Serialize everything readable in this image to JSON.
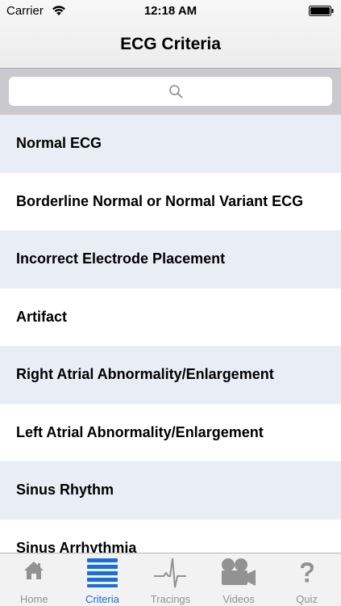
{
  "status_bar": {
    "carrier": "Carrier",
    "time": "12:18 AM"
  },
  "nav": {
    "title": "ECG Criteria"
  },
  "search": {
    "placeholder": ""
  },
  "list": {
    "items": [
      {
        "label": "Normal ECG"
      },
      {
        "label": "Borderline Normal or Normal Variant ECG"
      },
      {
        "label": "Incorrect Electrode Placement"
      },
      {
        "label": "Artifact"
      },
      {
        "label": "Right Atrial Abnormality/Enlargement"
      },
      {
        "label": "Left Atrial Abnormality/Enlargement"
      },
      {
        "label": "Sinus Rhythm"
      },
      {
        "label": "Sinus Arrhythmia"
      }
    ]
  },
  "tabbar": {
    "active": "Criteria",
    "tabs": [
      {
        "label": "Home",
        "icon": "home-icon"
      },
      {
        "label": "Criteria",
        "icon": "list-icon"
      },
      {
        "label": "Tracings",
        "icon": "ecg-tracing-icon"
      },
      {
        "label": "Videos",
        "icon": "video-camera-icon"
      },
      {
        "label": "Quiz",
        "icon": "question-mark-icon"
      }
    ]
  },
  "colors": {
    "accent": "#1a6ed8",
    "alt_row": "#e9edf6",
    "inactive_tab": "#929292"
  }
}
